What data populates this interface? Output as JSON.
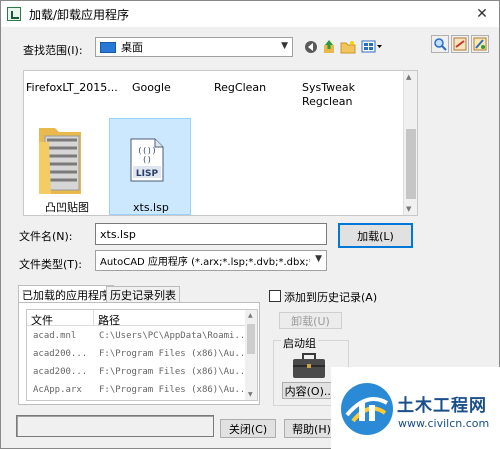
{
  "window": {
    "title": "加载/卸载应用程序"
  },
  "lookin": {
    "label": "查找范围(I):",
    "value": "桌面"
  },
  "files": {
    "top_row": [
      "FirefoxLT_2015...",
      "Google",
      "RegClean",
      "SysTweak\nRegclean"
    ],
    "items": [
      {
        "name": "凸凹贴图",
        "icon": "folder-icon"
      },
      {
        "name": "xts.lsp",
        "icon": "lisp-file-icon"
      }
    ]
  },
  "filename": {
    "label": "文件名(N):",
    "value": "xts.lsp"
  },
  "filetype": {
    "label": "文件类型(T):",
    "value": "AutoCAD 应用程序 (*.arx;*.lsp;*.dvb;*.dbx;*.vlx"
  },
  "buttons": {
    "load": "加载(L)",
    "unload": "卸载(U)",
    "contents": "内容(O)...",
    "close": "关闭(C)",
    "help": "帮助(H)"
  },
  "tabs": [
    "已加载的应用程序",
    "历史记录列表"
  ],
  "loaded_apps": {
    "headers": [
      "文件",
      "路径"
    ],
    "rows": [
      [
        "acad.mnl",
        "C:\\Users\\PC\\AppData\\Roami..."
      ],
      [
        "acad200...",
        "F:\\Program Files (x86)\\Au..."
      ],
      [
        "acad200...",
        "F:\\Program Files (x86)\\Au..."
      ],
      [
        "AcApp.arx",
        "F:\\Program Files (x86)\\Au..."
      ]
    ]
  },
  "history_checkbox": {
    "label": "添加到历史记录(A)",
    "checked": false
  },
  "startup_group": {
    "label": "启动组"
  },
  "watermark": {
    "brand": "土木工程网",
    "url": "www.civilcn.com"
  }
}
